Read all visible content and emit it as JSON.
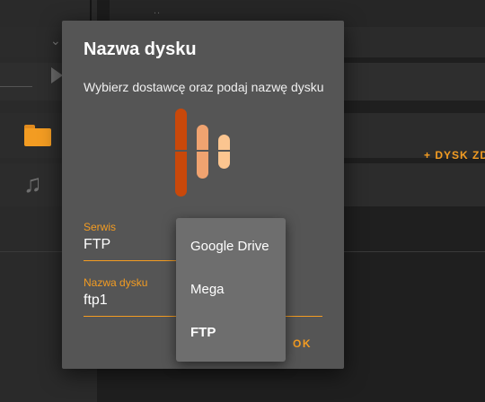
{
  "background": {
    "add_button_label": "+ DYSK ZD",
    "breadcrumb_dots": "..",
    "icons": [
      "chevron-down-icon",
      "play-icon",
      "folder-icon",
      "music-icon"
    ]
  },
  "dialog": {
    "title": "Nazwa dysku",
    "subtitle": "Wybierz dostawcę oraz podaj nazwę dysku",
    "service_label": "Serwis",
    "service_value": "FTP",
    "disk_name_label": "Nazwa dysku",
    "disk_name_value": "ftp1",
    "ok_label": "OK"
  },
  "service_menu": {
    "options": [
      "Google Drive",
      "Mega",
      "FTP"
    ],
    "selected": "FTP"
  },
  "colors": {
    "accent": "#f39c22",
    "dialog_bg": "#555555",
    "menu_bg": "#6e6e6e",
    "logo_dark": "#c9480a",
    "logo_mid": "#f0a370",
    "logo_light": "#fbc590"
  }
}
